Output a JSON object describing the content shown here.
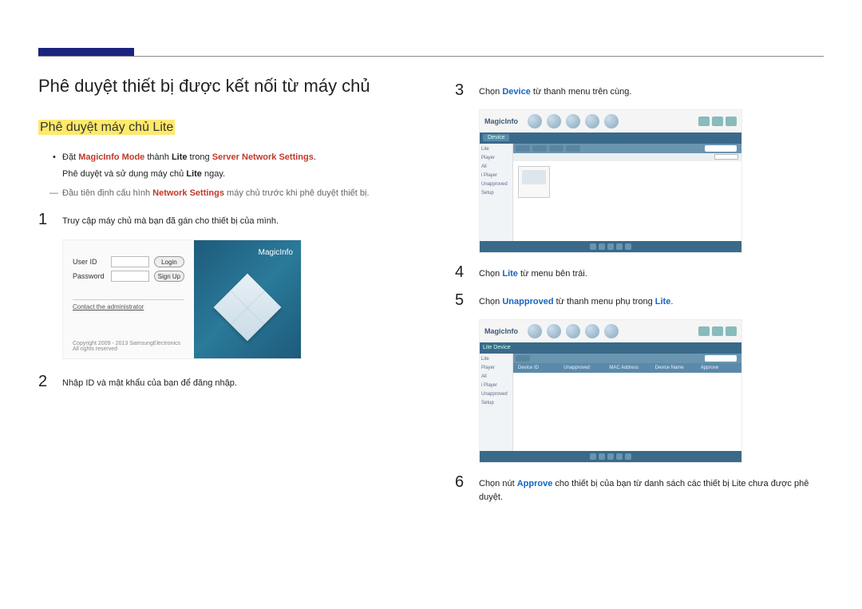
{
  "heading": "Phê duyệt thiết bị được kết nối từ máy chủ",
  "subheading": "Phê duyệt máy chủ Lite",
  "intro_bullet_pre": "Đặt ",
  "intro_bullet_em1": "MagicInfo Mode",
  "intro_bullet_mid1": " thành ",
  "intro_bullet_em2": "Lite",
  "intro_bullet_mid2": " trong ",
  "intro_bullet_em3": "Server Network Settings",
  "intro_bullet_post": ".",
  "intro_line2_pre": "Phê duyệt và sử dụng máy chủ ",
  "intro_line2_em": "Lite",
  "intro_line2_post": " ngay.",
  "note_pre": "Đầu tiên định cấu hình ",
  "note_em": "Network Settings",
  "note_post": " máy chủ trước khi phê duyệt thiết bị.",
  "step1_num": "1",
  "step1_text": "Truy cập máy chủ mà bạn đã gán cho thiết bị của mình.",
  "login": {
    "user_label": "User ID",
    "pass_label": "Password",
    "login_btn": "Login",
    "signup_btn": "Sign Up",
    "contact": "Contact the administrator",
    "footer": "Copyright 2009 - 2013 SamsungElectronics All rights reserved",
    "brand": "MagicInfo"
  },
  "step2_num": "2",
  "step2_text": "Nhập ID và mật khẩu của bạn để đăng nhập.",
  "step3_num": "3",
  "step3_pre": "Chọn ",
  "step3_em": "Device",
  "step3_post": " từ thanh menu trên cùng.",
  "step4_num": "4",
  "step4_pre": "Chọn ",
  "step4_em": "Lite",
  "step4_post": " từ menu bên trái.",
  "step5_num": "5",
  "step5_pre": "Chọn ",
  "step5_em1": "Unapproved",
  "step5_mid": " từ thanh menu phụ trong ",
  "step5_em2": "Lite",
  "step5_post": ".",
  "step6_num": "6",
  "step6_pre": "Chọn nút ",
  "step6_em": "Approve",
  "step6_post": " cho thiết bị của bạn từ danh sách các thiết bị Lite chưa được phê duyệt.",
  "app": {
    "brand": "MagicInfo",
    "tab_active": "Device",
    "sidebar": [
      "Lite",
      "Player",
      "All",
      "i Player",
      "Unapproved",
      "Setup"
    ],
    "tbl_headers": [
      "Device ID",
      "Unapproved",
      "MAC Address",
      "Device Name",
      "Approve"
    ]
  }
}
